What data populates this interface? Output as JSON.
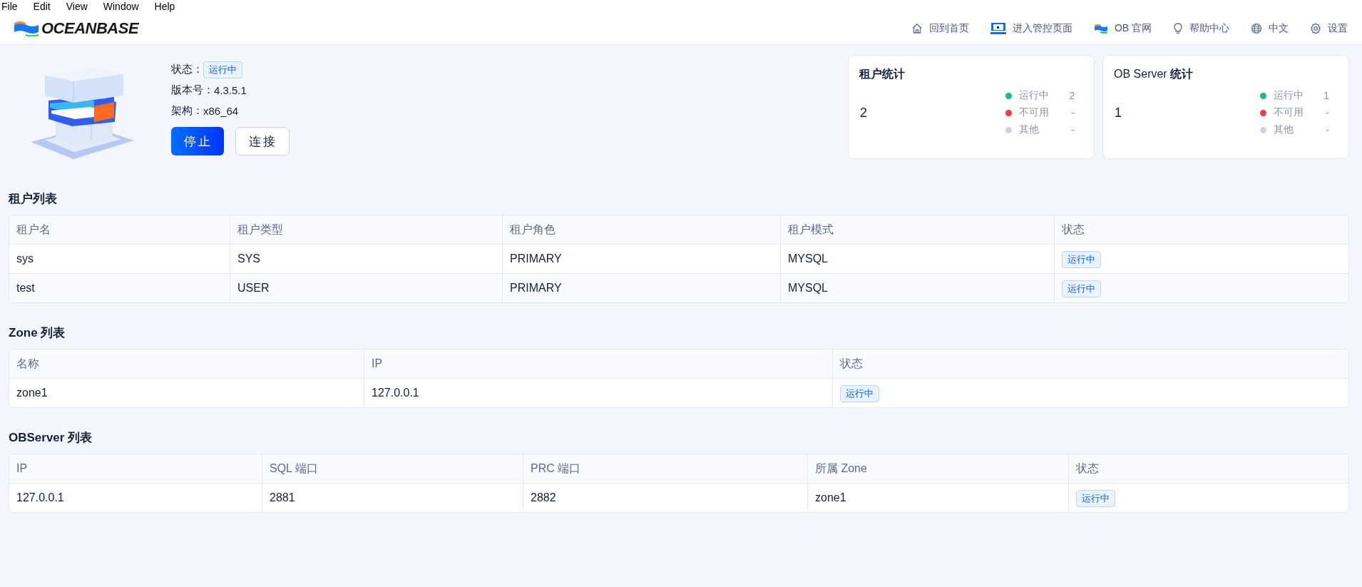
{
  "menu": [
    "File",
    "Edit",
    "View",
    "Window",
    "Help"
  ],
  "header": {
    "logo": "OCEANBASE",
    "nav": [
      {
        "kind": "home",
        "label": "回到首页"
      },
      {
        "kind": "console",
        "label": "进入管控页面"
      },
      {
        "kind": "flag",
        "label": "OB 官网"
      },
      {
        "kind": "bulb",
        "label": "帮助中心"
      },
      {
        "kind": "globe",
        "label": "中文"
      },
      {
        "kind": "gear",
        "label": "设置"
      }
    ]
  },
  "cluster": {
    "status_label": "状态：",
    "status": "运行中",
    "version_label": "版本号：",
    "version": "4.3.5.1",
    "arch_label": "架构：",
    "arch": "x86_64",
    "buttons": [
      {
        "kind": "primary",
        "label": "停止"
      },
      {
        "kind": "default",
        "label": "连接"
      }
    ]
  },
  "stats": [
    {
      "title": "**租户统计**",
      "total": "2",
      "items": [
        {
          "label": "运行中",
          "count": "2",
          "color": "#12bf7f"
        },
        {
          "label": "不可用",
          "count": "-",
          "color": "#f23d3d"
        },
        {
          "label": "其他",
          "count": "-",
          "color": "#cdd4e2"
        }
      ]
    },
    {
      "title": "OB Server **统计**",
      "total": "1",
      "items": [
        {
          "label": "运行中",
          "count": "1",
          "color": "#12bf7f"
        },
        {
          "label": "不可用",
          "count": "-",
          "color": "#f23d3d"
        },
        {
          "label": "其他",
          "count": "-",
          "color": "#cdd4e2"
        }
      ]
    }
  ],
  "tables": [
    {
      "title": "租户列表",
      "columns": [
        {
          "label": "租户名",
          "kind": "text"
        },
        {
          "label": "租户类型",
          "kind": "text"
        },
        {
          "label": "租户角色",
          "kind": "text"
        },
        {
          "label": "租户模式",
          "kind": "text"
        },
        {
          "label": "状态",
          "kind": "status"
        }
      ],
      "rows": [
        [
          "sys",
          "SYS",
          "PRIMARY",
          "MYSQL",
          "运行中"
        ],
        [
          "test",
          "USER",
          "PRIMARY",
          "MYSQL",
          "运行中"
        ]
      ]
    },
    {
      "title": "Zone 列表",
      "columns": [
        {
          "label": "名称",
          "kind": "text"
        },
        {
          "label": "IP",
          "kind": "text"
        },
        {
          "label": "状态",
          "kind": "status"
        }
      ],
      "rows": [
        [
          "zone1",
          "127.0.0.1",
          "运行中"
        ]
      ]
    },
    {
      "title": "OBServer 列表",
      "columns": [
        {
          "label": "IP",
          "kind": "text"
        },
        {
          "label": "SQL 端口",
          "kind": "text"
        },
        {
          "label": "PRC 端口",
          "kind": "text"
        },
        {
          "label": "所属 Zone",
          "kind": "text"
        },
        {
          "label": "状态",
          "kind": "status"
        }
      ],
      "rows": [
        [
          "127.0.0.1",
          "2881",
          "2882",
          "zone1",
          "运行中"
        ]
      ]
    }
  ]
}
